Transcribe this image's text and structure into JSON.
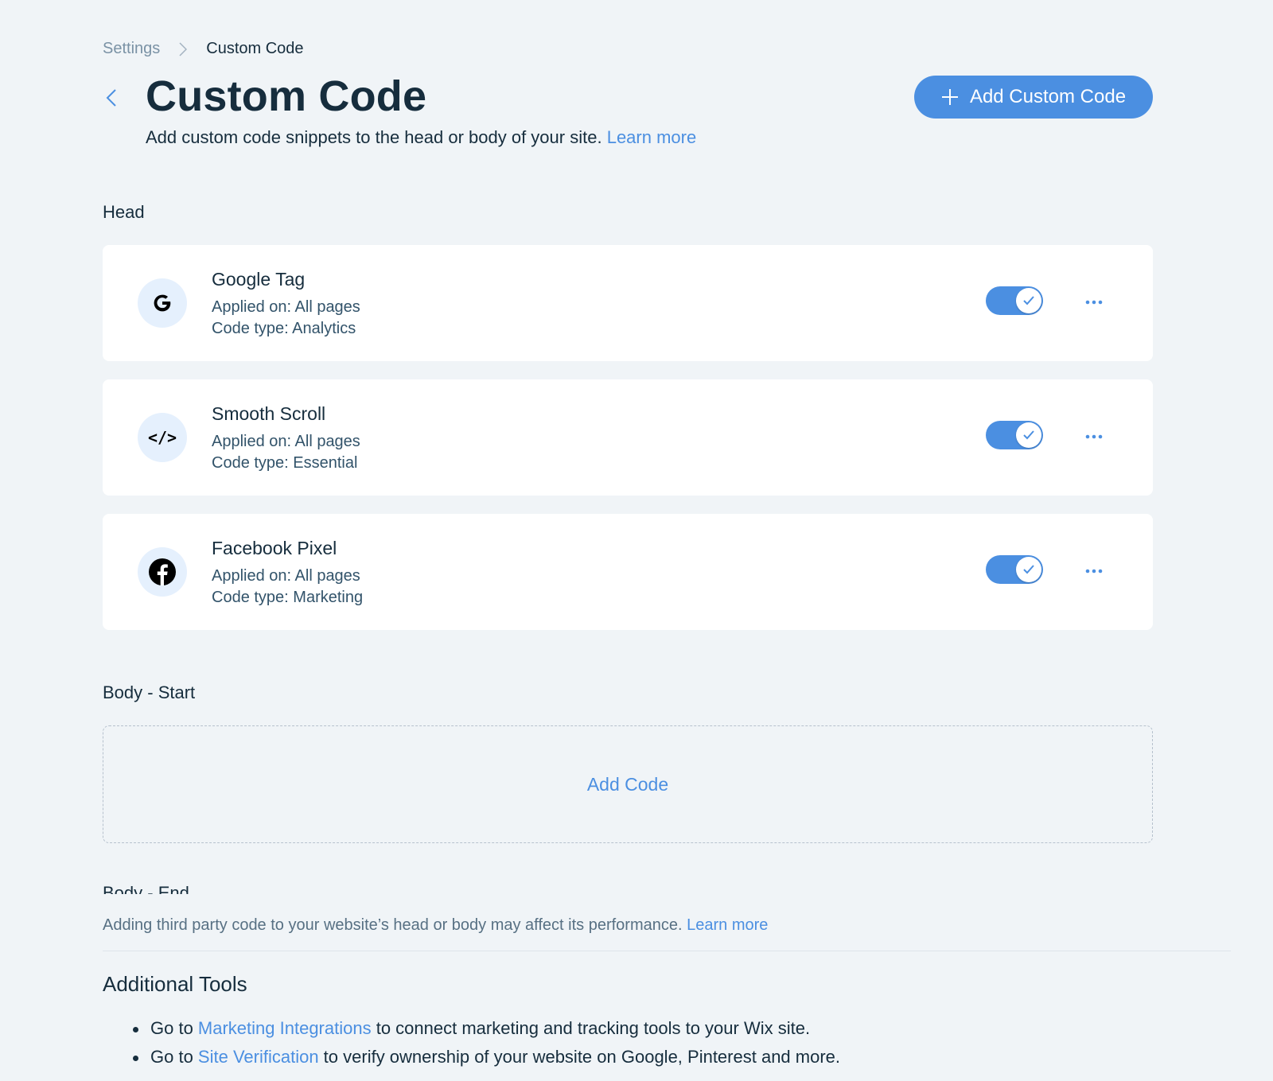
{
  "breadcrumb": {
    "parent": "Settings",
    "current": "Custom Code"
  },
  "header": {
    "title": "Custom Code",
    "subtitle": "Add custom code snippets to the head or body of your site.",
    "subtitle_link": "Learn more",
    "add_button_label": "Add Custom Code"
  },
  "sections": {
    "head_label": "Head",
    "body_start_label": "Body - Start",
    "body_end_label": "Body - End",
    "add_code_label": "Add Code"
  },
  "snippets": [
    {
      "name": "Google Tag",
      "applied": "Applied on: All pages",
      "type": "Code type: Analytics",
      "icon": "google-icon",
      "enabled": true
    },
    {
      "name": "Smooth Scroll",
      "applied": "Applied on: All pages",
      "type": "Code type: Essential",
      "icon": "code-icon",
      "enabled": true
    },
    {
      "name": "Facebook Pixel",
      "applied": "Applied on: All pages",
      "type": "Code type: Marketing",
      "icon": "facebook-icon",
      "enabled": true
    }
  ],
  "footer": {
    "note": "Adding third party code to your website’s head or body may affect its performance.",
    "note_link": "Learn more",
    "tools_title": "Additional Tools",
    "tools": [
      {
        "prefix": "Go to ",
        "link": "Marketing Integrations",
        "suffix": " to connect marketing and tracking tools to your Wix site."
      },
      {
        "prefix": "Go to ",
        "link": "Site Verification",
        "suffix": " to verify ownership of your website on Google, Pinterest and more."
      }
    ]
  },
  "colors": {
    "accent": "#4b8fe1",
    "background": "#f0f4f7",
    "text": "#162d3d",
    "icon_bg": "#e5f0fd"
  }
}
